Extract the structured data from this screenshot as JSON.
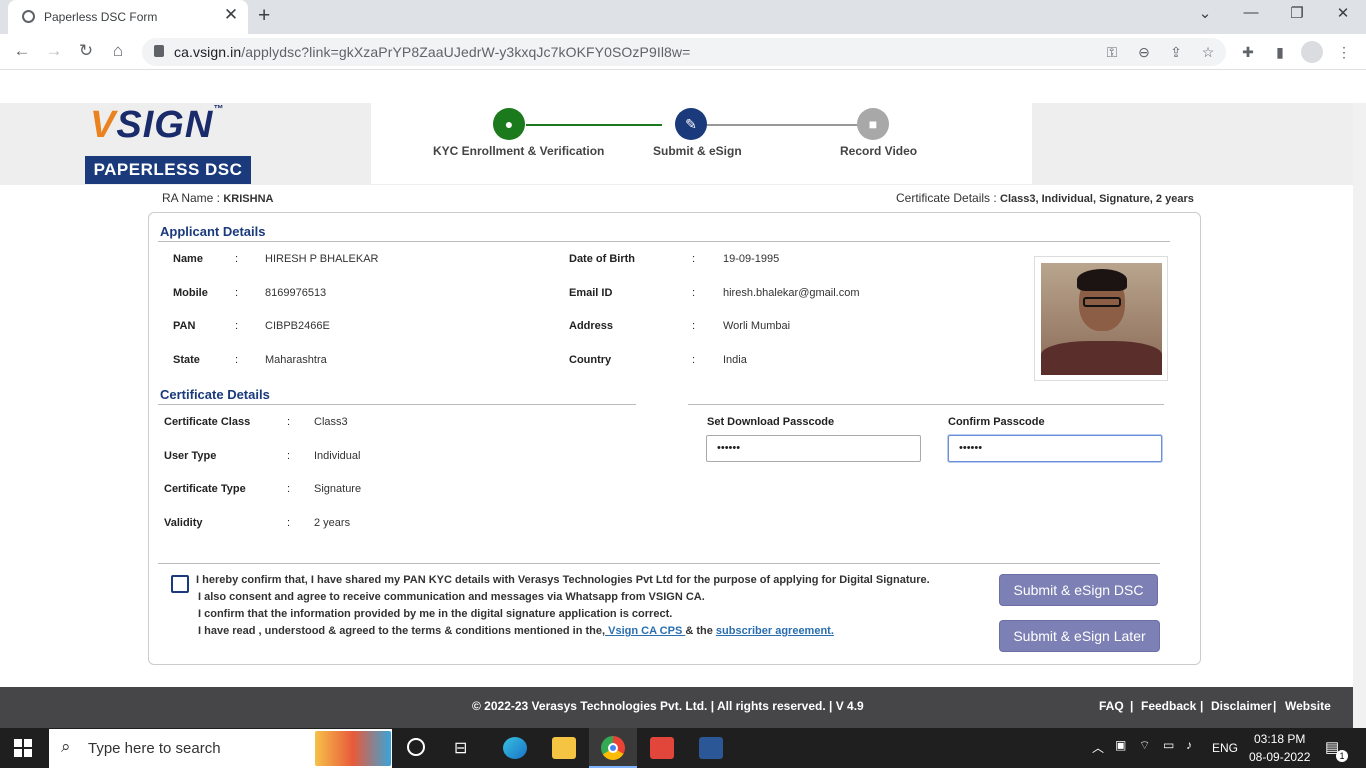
{
  "browser": {
    "tab_title": "Paperless DSC Form",
    "tab_close": "✕",
    "new_tab": "+",
    "url_host": "ca.vsign.in",
    "url_path": "/applydsc?link=gkXzaPrYP8ZaaUJedrW-y3kxqJc7kOKFY0SOzP9Il8w="
  },
  "header": {
    "logo_text": "SIGN",
    "logo_v": "V",
    "logo_tm": "™",
    "logo_sub": "PAPERLESS DSC",
    "steps": [
      {
        "label": "KYC Enrollment & Verification",
        "color": "#1b7a1b"
      },
      {
        "label": "Submit & eSign",
        "color": "#1a3a7c"
      },
      {
        "label": "Record Video",
        "color": "#a8a8a8"
      }
    ]
  },
  "meta": {
    "ra_label": "RA Name : ",
    "ra_value": "KRISHNA",
    "cert_label": "Certificate Details : ",
    "cert_value": "Class3, Individual, Signature, 2 years"
  },
  "applicant": {
    "heading": "Applicant Details",
    "colon": ":",
    "name_label": "Name",
    "name_value": "HIRESH P BHALEKAR",
    "mobile_label": "Mobile",
    "mobile_value": "8169976513",
    "pan_label": "PAN",
    "pan_value": "CIBPB2466E",
    "state_label": "State",
    "state_value": "Maharashtra",
    "dob_label": "Date of Birth",
    "dob_value": "19-09-1995",
    "email_label": "Email ID",
    "email_value": "hiresh.bhalekar@gmail.com",
    "address_label": "Address",
    "address_value": "Worli Mumbai",
    "country_label": "Country",
    "country_value": "India"
  },
  "certificate": {
    "heading": "Certificate Details",
    "class_label": "Certificate Class",
    "class_value": "Class3",
    "usertype_label": "User Type",
    "usertype_value": "Individual",
    "type_label": "Certificate Type",
    "type_value": "Signature",
    "validity_label": "Validity",
    "validity_value": "2 years"
  },
  "passcode": {
    "set_label": "Set Download Passcode",
    "set_value": "••••••",
    "confirm_label": "Confirm Passcode",
    "confirm_value": "••••••"
  },
  "consent": {
    "line1": "I hereby confirm that, I have shared my PAN KYC details with Verasys Technologies Pvt Ltd for the purpose of applying for Digital Signature.",
    "line2": "I also consent and agree to receive communication and messages via Whatsapp from VSIGN CA.",
    "line3": "I confirm that the information provided by me in the digital signature application is correct.",
    "line4_pre": "I have read , understood & agreed to the terms & conditions mentioned in the,",
    "link_cps": " Vsign CA CPS ",
    "line4_mid": "& the ",
    "link_agreement": "subscriber agreement."
  },
  "buttons": {
    "submit_now": "Submit & eSign DSC",
    "submit_later": "Submit & eSign Later"
  },
  "footer": {
    "copyright": "©  2022-23  Verasys Technologies Pvt. Ltd. | All rights reserved. | V 4.9",
    "links": [
      "FAQ",
      "Feedback",
      "Disclaimer",
      "Website"
    ],
    "sep": "|"
  },
  "taskbar": {
    "search_placeholder": "Type here to search",
    "lang": "ENG",
    "time": "03:18 PM",
    "date": "08-09-2022",
    "notif_count": "1"
  }
}
